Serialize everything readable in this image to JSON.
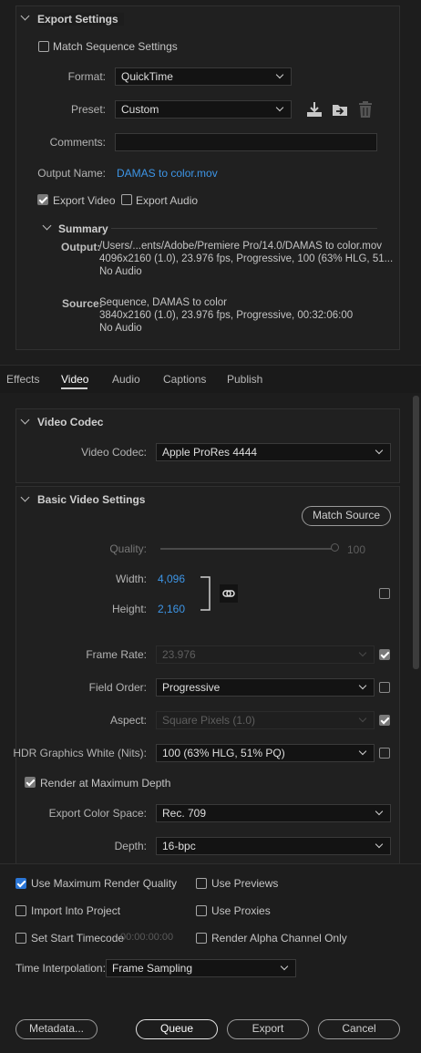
{
  "export_settings": {
    "header": "Export Settings",
    "match_sequence": "Match Sequence Settings",
    "format_label": "Format:",
    "format_value": "QuickTime",
    "preset_label": "Preset:",
    "preset_value": "Custom",
    "comments_label": "Comments:",
    "comments_value": "",
    "output_name_label": "Output Name:",
    "output_name_value": "DAMAS to color.mov",
    "export_video": "Export Video",
    "export_audio": "Export Audio",
    "export_video_checked": true,
    "export_audio_checked": false
  },
  "summary": {
    "header": "Summary",
    "output_label": "Output:",
    "output_line1": "/Users/...ents/Adobe/Premiere Pro/14.0/DAMAS to color.mov",
    "output_line2": "4096x2160 (1.0), 23.976 fps, Progressive, 100 (63% HLG, 51...",
    "output_line3": "No Audio",
    "source_label": "Source:",
    "source_line1": "Sequence, DAMAS to color",
    "source_line2": "3840x2160 (1.0), 23.976 fps, Progressive, 00:32:06:00",
    "source_line3": "No Audio"
  },
  "tabs": [
    "Effects",
    "Video",
    "Audio",
    "Captions",
    "Publish"
  ],
  "active_tab": "Video",
  "video_codec": {
    "header": "Video Codec",
    "label": "Video Codec:",
    "value": "Apple ProRes 4444"
  },
  "basic_video": {
    "header": "Basic Video Settings",
    "match_source": "Match Source",
    "quality_label": "Quality:",
    "quality_value": "100",
    "quality_level": 1.0,
    "width_label": "Width:",
    "width_value": "4,096",
    "height_label": "Height:",
    "height_value": "2,160",
    "frame_rate_label": "Frame Rate:",
    "frame_rate_value": "23.976",
    "field_order_label": "Field Order:",
    "field_order_value": "Progressive",
    "aspect_label": "Aspect:",
    "aspect_value": "Square Pixels (1.0)",
    "hdr_label": "HDR Graphics White (Nits):",
    "hdr_value": "100 (63% HLG, 51% PQ)",
    "render_max_depth": "Render at Maximum Depth",
    "color_space_label": "Export Color Space:",
    "color_space_value": "Rec. 709",
    "depth_label": "Depth:",
    "depth_value": "16-bpc"
  },
  "bottom": {
    "use_max_render": "Use Maximum Render Quality",
    "use_previews": "Use Previews",
    "import_into_project": "Import Into Project",
    "use_proxies": "Use Proxies",
    "set_start_timecode": "Set Start Timecode",
    "start_timecode_value": "00:00:00:00",
    "render_alpha": "Render Alpha Channel Only",
    "time_interp_label": "Time Interpolation:",
    "time_interp_value": "Frame Sampling"
  },
  "buttons": {
    "metadata": "Metadata...",
    "queue": "Queue",
    "export": "Export",
    "cancel": "Cancel"
  },
  "icons": {
    "save_preset": "download-preset-icon",
    "import_preset": "import-preset-icon",
    "delete_preset": "trash-icon",
    "link": "chain-link-icon"
  },
  "colors": {
    "accent_blue": "#3d95e6",
    "checkbox_blue": "#2b76d6",
    "background": "#1d1d1d"
  }
}
